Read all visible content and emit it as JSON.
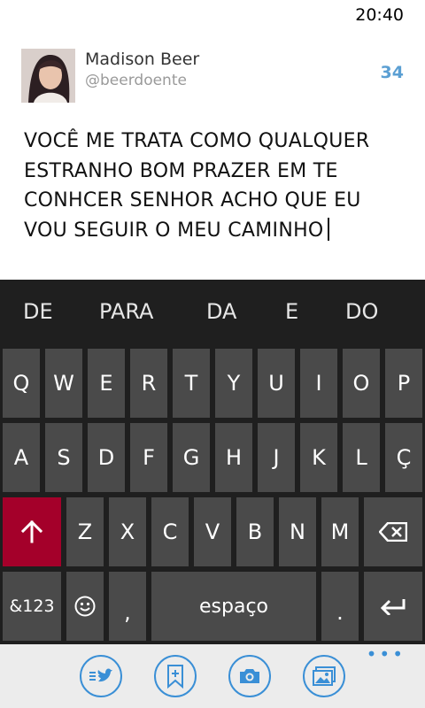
{
  "status_bar": {
    "time": "20:40"
  },
  "compose": {
    "user_name": "Madison Beer",
    "user_handle": "@beerdoente",
    "char_count": "34",
    "tweet_lines": [
      "VOCÊ ME TRATA COMO QUALQUER",
      "ESTRANHO BOM PRAZER EM TE",
      "CONHCER SENHOR ACHO QUE EU",
      "VOU SEGUIR O MEU CAMINHO"
    ]
  },
  "keyboard": {
    "suggestions": [
      "DE",
      "PARA",
      "DA",
      "E",
      "DO"
    ],
    "row1": [
      "Q",
      "W",
      "E",
      "R",
      "T",
      "Y",
      "U",
      "I",
      "O",
      "P"
    ],
    "row2": [
      "A",
      "S",
      "D",
      "F",
      "G",
      "H",
      "J",
      "K",
      "L",
      "Ç"
    ],
    "row3": [
      "Z",
      "X",
      "C",
      "V",
      "B",
      "N",
      "M"
    ],
    "symbols_label": "&123",
    "comma_label": ",",
    "space_label": "espaço",
    "period_label": ".",
    "shift_color": "#a4002a",
    "key_color": "#4a4a4a"
  },
  "app_bar": {
    "buttons": [
      "twitter-compose-icon",
      "bookmark-add-icon",
      "camera-icon",
      "gallery-icon"
    ],
    "more_label": "•••",
    "accent": "#3a8fd6"
  }
}
